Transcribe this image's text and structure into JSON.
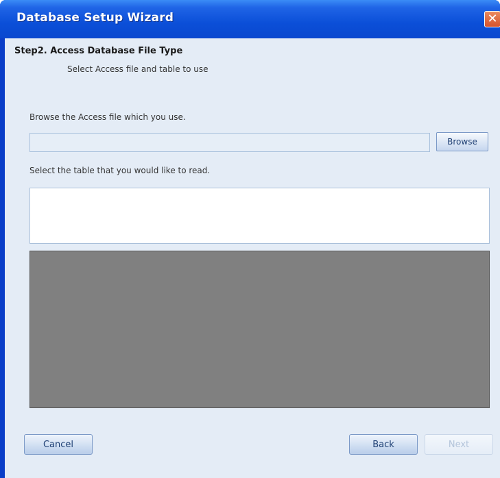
{
  "window": {
    "title": "Database Setup Wizard",
    "close_symbol": "✕"
  },
  "header": {
    "step_title": "Step2. Access Database File Type",
    "step_subtitle": "Select Access file and table to use"
  },
  "file": {
    "label": "Browse the Access file which you use.",
    "value": "",
    "placeholder": "",
    "browse_label": "Browse"
  },
  "table": {
    "label": "Select the table that you would like to read.",
    "items": []
  },
  "footer": {
    "cancel_label": "Cancel",
    "back_label": "Back",
    "next_label": "Next",
    "next_enabled": false
  }
}
